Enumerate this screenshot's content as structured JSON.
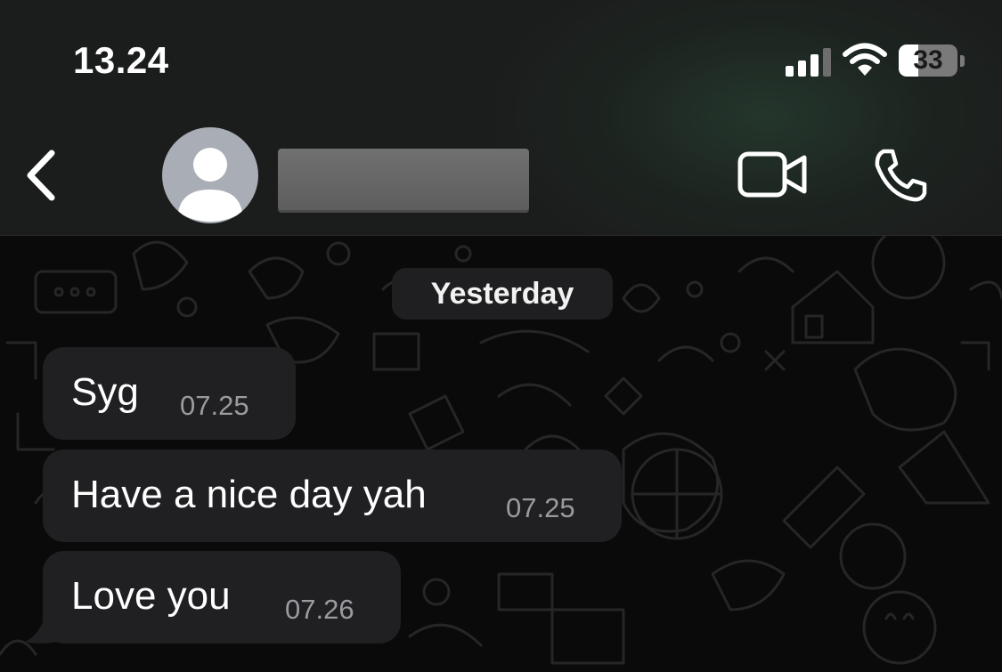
{
  "status_bar": {
    "time": "13.24",
    "battery_level": "33",
    "signal_bars_active": 3,
    "signal_bars_total": 4
  },
  "nav": {
    "back_icon": "chevron-left-icon",
    "avatar_icon": "person-silhouette-icon",
    "video_icon": "video-camera-icon",
    "call_icon": "phone-icon"
  },
  "chat": {
    "date_separator": "Yesterday",
    "messages": [
      {
        "text": "Syg",
        "time": "07.25"
      },
      {
        "text": "Have a nice day yah",
        "time": "07.25"
      },
      {
        "text": "Love you",
        "time": "07.26"
      }
    ]
  },
  "colors": {
    "bubble_incoming": "#202023",
    "chat_background": "#0a0a0a",
    "header_background": "#1b1c1c",
    "timestamp": "#9a9aa0",
    "avatar_background": "#a9adb6"
  }
}
